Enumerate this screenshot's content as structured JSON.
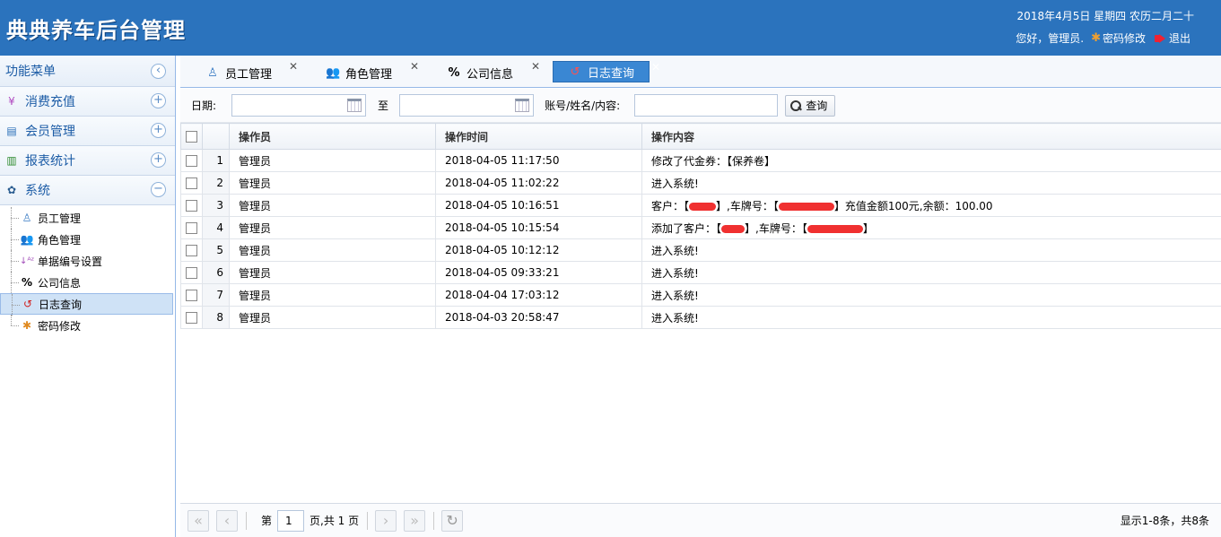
{
  "header": {
    "logo": "典典养车后台管理",
    "date": "2018年4月5日 星期四 农历二月二十",
    "greeting": "您好，管理员.",
    "change_password": "密码修改",
    "logout": "退出"
  },
  "sidebar": {
    "title": "功能菜单",
    "panels": [
      {
        "label": "消费充值",
        "icon": "yen-icon"
      },
      {
        "label": "会员管理",
        "icon": "card-icon"
      },
      {
        "label": "报表统计",
        "icon": "chart-icon"
      },
      {
        "label": "系统",
        "icon": "gear-icon"
      }
    ],
    "system_items": [
      {
        "label": "员工管理",
        "icon": "user-icon"
      },
      {
        "label": "角色管理",
        "icon": "users-icon"
      },
      {
        "label": "单据编号设置",
        "icon": "sort-az-icon"
      },
      {
        "label": "公司信息",
        "icon": "percent-icon"
      },
      {
        "label": "日志查询",
        "icon": "history-icon"
      },
      {
        "label": "密码修改",
        "icon": "asterisk-icon"
      }
    ]
  },
  "tabs": [
    {
      "label": "员工管理"
    },
    {
      "label": "角色管理"
    },
    {
      "label": "公司信息"
    },
    {
      "label": "日志查询"
    }
  ],
  "search": {
    "date_label": "日期:",
    "to_label": "至",
    "keyword_label": "账号/姓名/内容:",
    "search_button": "查询"
  },
  "grid": {
    "columns": [
      "操作员",
      "操作时间",
      "操作内容"
    ],
    "rows": [
      {
        "num": "1",
        "operator": "管理员",
        "time": "2018-04-05 11:17:50",
        "content": "修改了代金券：【保养卷】"
      },
      {
        "num": "2",
        "operator": "管理员",
        "time": "2018-04-05 11:02:22",
        "content": "进入系统!"
      },
      {
        "num": "3",
        "operator": "管理员",
        "time": "2018-04-05 10:16:51",
        "content_parts": [
          "客户：【",
          "】,车牌号：【",
          "】充值金额100元,余额：100.00"
        ]
      },
      {
        "num": "4",
        "operator": "管理员",
        "time": "2018-04-05 10:15:54",
        "content_parts": [
          "添加了客户：【",
          "】,车牌号：【",
          "】"
        ]
      },
      {
        "num": "5",
        "operator": "管理员",
        "time": "2018-04-05 10:12:12",
        "content": "进入系统!"
      },
      {
        "num": "6",
        "operator": "管理员",
        "time": "2018-04-05 09:33:21",
        "content": "进入系统!"
      },
      {
        "num": "7",
        "operator": "管理员",
        "time": "2018-04-04 17:03:12",
        "content": "进入系统!"
      },
      {
        "num": "8",
        "operator": "管理员",
        "time": "2018-04-03 20:58:47",
        "content": "进入系统!"
      }
    ]
  },
  "pager": {
    "page_prefix": "第",
    "page_value": "1",
    "page_suffix": "页,共 1 页",
    "info": "显示1-8条，共8条"
  },
  "colors": {
    "header_bg": "#2b73bd",
    "active_tab": "#3a87d3",
    "redaction": "#f03030"
  }
}
